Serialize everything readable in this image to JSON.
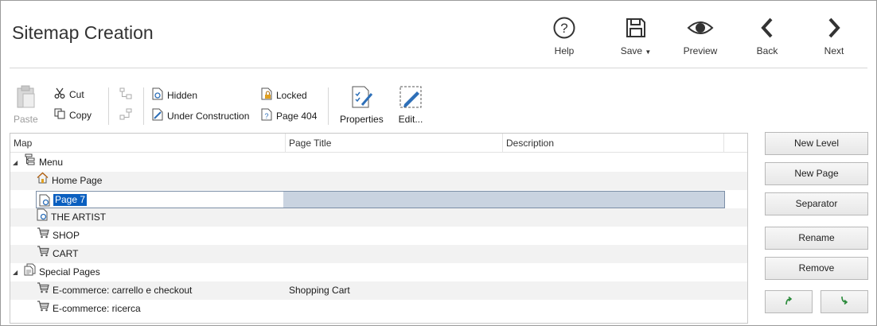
{
  "header": {
    "title": "Sitemap Creation",
    "buttons": {
      "help": "Help",
      "save": "Save",
      "preview": "Preview",
      "back": "Back",
      "next": "Next"
    }
  },
  "toolbar": {
    "paste": "Paste",
    "cut": "Cut",
    "copy": "Copy",
    "hidden": "Hidden",
    "under_construction": "Under Construction",
    "locked": "Locked",
    "page_404": "Page 404",
    "properties": "Properties",
    "edit": "Edit..."
  },
  "grid": {
    "columns": [
      "Map",
      "Page Title",
      "Description"
    ],
    "rows": [
      {
        "label": "Menu",
        "icon": "menu-level-icon",
        "title": "",
        "description": ""
      },
      {
        "label": "Home Page",
        "icon": "home-icon",
        "title": "",
        "description": ""
      },
      {
        "label": "Page 7",
        "icon": "page-icon",
        "title": "",
        "description": "",
        "selected": true
      },
      {
        "label": "THE ARTIST",
        "icon": "page-icon",
        "title": "",
        "description": ""
      },
      {
        "label": "SHOP",
        "icon": "cart-icon",
        "title": "",
        "description": ""
      },
      {
        "label": "CART",
        "icon": "cart-icon",
        "title": "",
        "description": ""
      },
      {
        "label": "Special Pages",
        "icon": "special-pages-icon",
        "title": "",
        "description": ""
      },
      {
        "label": "E-commerce: carrello e checkout",
        "icon": "cart-icon",
        "title": "Shopping Cart",
        "description": ""
      },
      {
        "label": "E-commerce: ricerca",
        "icon": "cart-icon",
        "title": "",
        "description": ""
      }
    ]
  },
  "side_buttons": {
    "new_level": "New Level",
    "new_page": "New Page",
    "separator": "Separator",
    "rename": "Rename",
    "remove": "Remove"
  },
  "colors": {
    "selection": "#0a5fc0",
    "accent": "#2d6fb8"
  }
}
